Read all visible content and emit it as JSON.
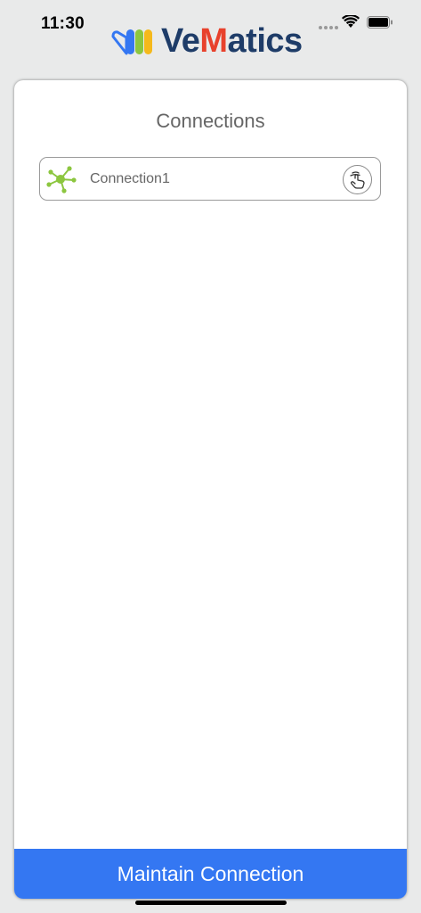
{
  "status_bar": {
    "time": "11:30",
    "wifi_icon": "wifi-icon",
    "battery_icon": "battery-icon"
  },
  "header": {
    "logo_text_prefix": "Ve",
    "logo_text_m": "M",
    "logo_text_suffix": "atics",
    "logo_icon": "vematics-logo-icon"
  },
  "main": {
    "title": "Connections",
    "connections": [
      {
        "label": "Connection1",
        "icon": "network-hub-icon",
        "action_icon": "tap-hand-icon"
      }
    ]
  },
  "footer": {
    "maintain_label": "Maintain Connection"
  },
  "colors": {
    "accent": "#3477f2",
    "logo_navy": "#1e3c68",
    "logo_red": "#e8412c",
    "network_green": "#8cc63f",
    "background": "#e9eaea"
  }
}
